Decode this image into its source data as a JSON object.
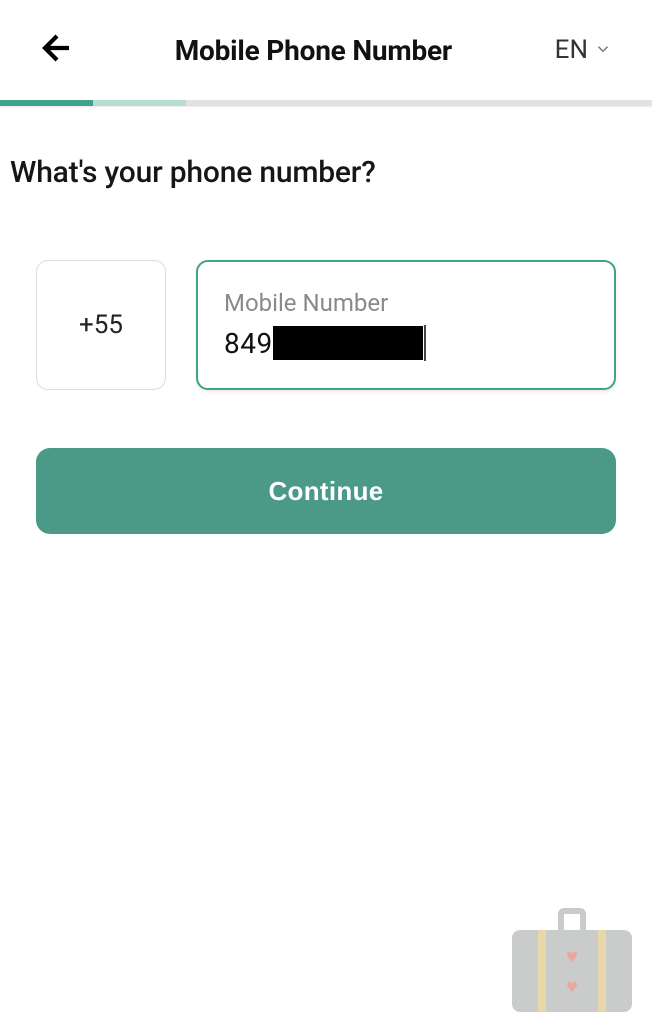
{
  "header": {
    "title": "Mobile Phone Number",
    "language": "EN"
  },
  "heading": "What's your phone number?",
  "phone": {
    "country_code": "+55",
    "label": "Mobile Number",
    "value": "849"
  },
  "continue_label": "Continue"
}
